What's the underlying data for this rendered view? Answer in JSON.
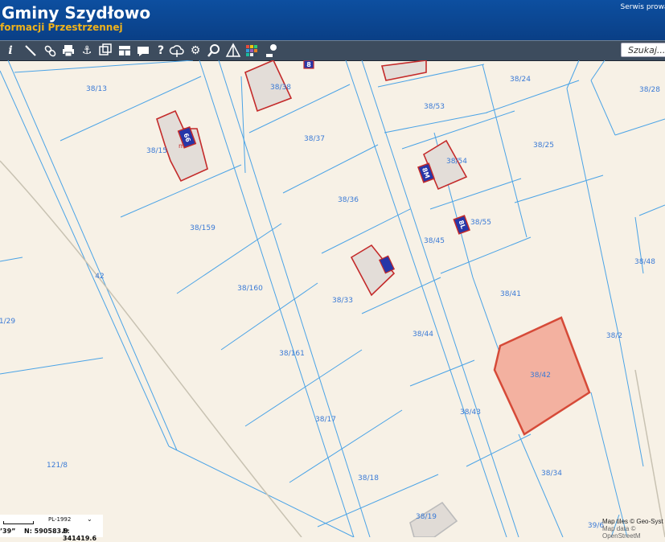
{
  "header": {
    "title": "Gminy Szydłowo",
    "subtitle": "formacji Przestrzennej",
    "service_note": "Serwis prowadzony p"
  },
  "toolbar": {
    "tools": [
      "info-icon",
      "measure-line-icon",
      "link-icon",
      "print-icon",
      "anchor-icon",
      "layers-copy-icon",
      "layout-icon",
      "speech-icon",
      "help-icon",
      "cloud-upload-icon",
      "settings-icon",
      "zoom-search-icon",
      "triangle-icon",
      "color-grid-icon",
      "marker-icon"
    ],
    "search_placeholder": "Szukaj..."
  },
  "map": {
    "parcels": [
      "38/13",
      "38/38",
      "38/24",
      "38/28",
      "38/53",
      "38/15",
      "38/37",
      "38/25",
      "38/54",
      "38/36",
      "38/159",
      "38/55",
      "38/45",
      "38/48",
      "38/160",
      "38/41",
      "42",
      "38/33",
      "1/29",
      "38/44",
      "38/2",
      "38/161",
      "38/42",
      "38/17",
      "38/43",
      "121/8",
      "38/34",
      "38/18",
      "38/19",
      "39/6"
    ],
    "building_numbers": [
      "66",
      "8M",
      "8L",
      "8"
    ],
    "selected_parcel": "38/42"
  },
  "footer": {
    "crs": "PL-1992",
    "coord_dms": "’39”",
    "coord_n": "N: 590583.9",
    "coord_e": "E: 341419.6",
    "attribution_1": "Map tiles © Geo-Syst",
    "attribution_2": "Map data © OpenStreetM"
  },
  "colors": {
    "header_blue": "#0d4fa0",
    "subtitle_orange": "#f0b21a",
    "parcel_line": "#4aa3e6",
    "building_outline": "#c42a2a",
    "selected_fill": "#f3b1a0"
  }
}
